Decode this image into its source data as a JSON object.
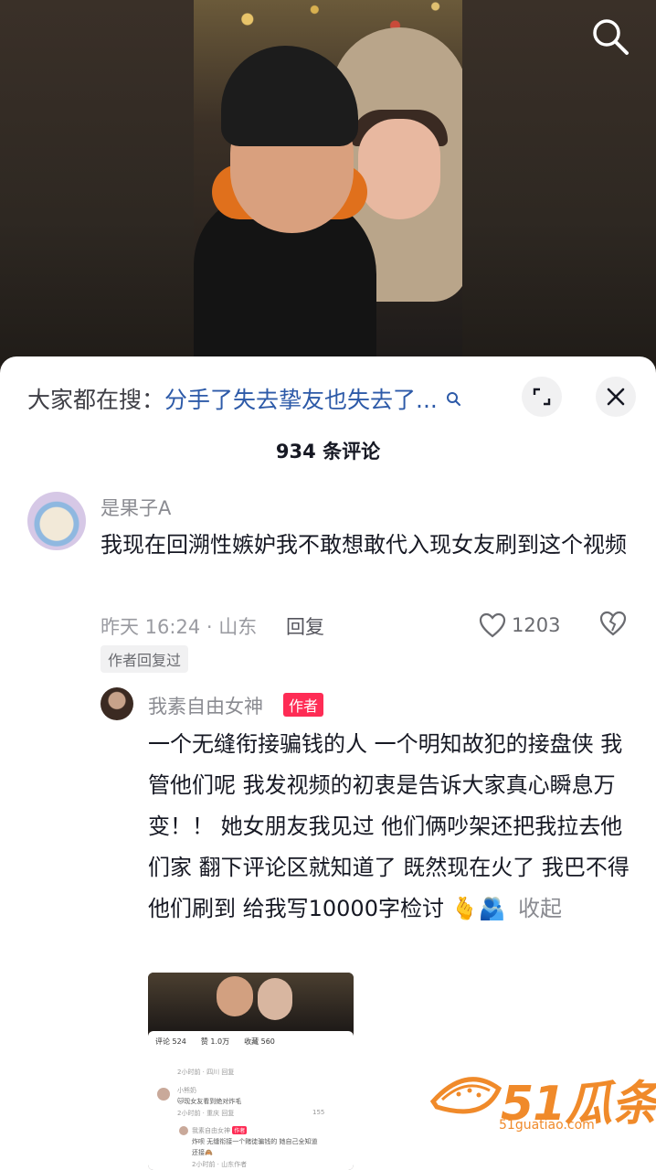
{
  "hot_search": {
    "prefix": "大家都在搜：",
    "query": "分手了失去挚友也失去了..."
  },
  "comments_header": {
    "count_label": "934 条评论"
  },
  "comment": {
    "username": "是果子A",
    "text": "我现在回溯性嫉妒我不敢想敢代入现女友刷到这个视频",
    "meta": "昨天 16:24 · 山东",
    "reply_label": "回复",
    "likes": "1203",
    "author_replied_tag": "作者回复过"
  },
  "reply": {
    "username": "我素自由女神",
    "badge": "作者",
    "text": "一个无缝衔接骗钱的人 一个明知故犯的接盘侠 我管他们呢 我发视频的初衷是告诉大家真心瞬息万变！！ 她女朋友我见过 他们俩吵架还把我拉去他们家 翻下评论区就知道了 既然现在火了 我巴不得他们刷到 给我写10000字检讨",
    "emojis": "🫰🫂",
    "collapse_label": "收起"
  },
  "thumbnail": {
    "header_comments": "评论 524",
    "header_likes": "赞 1.0万",
    "header_favs": "收藏 560",
    "row1_meta": "2小时前 · 四川   回复",
    "row2_user": "小熊奶",
    "row2_text": "🐱现女友看到绝对炸毛",
    "row2_meta": "2小时前 · 重庆   回复",
    "row2_likes": "155",
    "row3_user": "我素自由女神",
    "row3_badge": "作者",
    "row3_text": "炸呗 无缝衔接一个赌徒骗钱的 她自己全知道",
    "row3_text2": "还接🙈",
    "row3_meta": "2小时前 · 山东作者"
  },
  "watermark": {
    "brand": "51瓜条",
    "domain": "51guatiao.com"
  },
  "colors": {
    "link": "#2d5aa8",
    "author_badge": "#fe2c55",
    "watermark": "#f08a2a"
  },
  "icons": [
    "search-icon",
    "expand-icon",
    "close-icon",
    "hot-search-icon",
    "heart-icon",
    "broken-heart-icon"
  ]
}
